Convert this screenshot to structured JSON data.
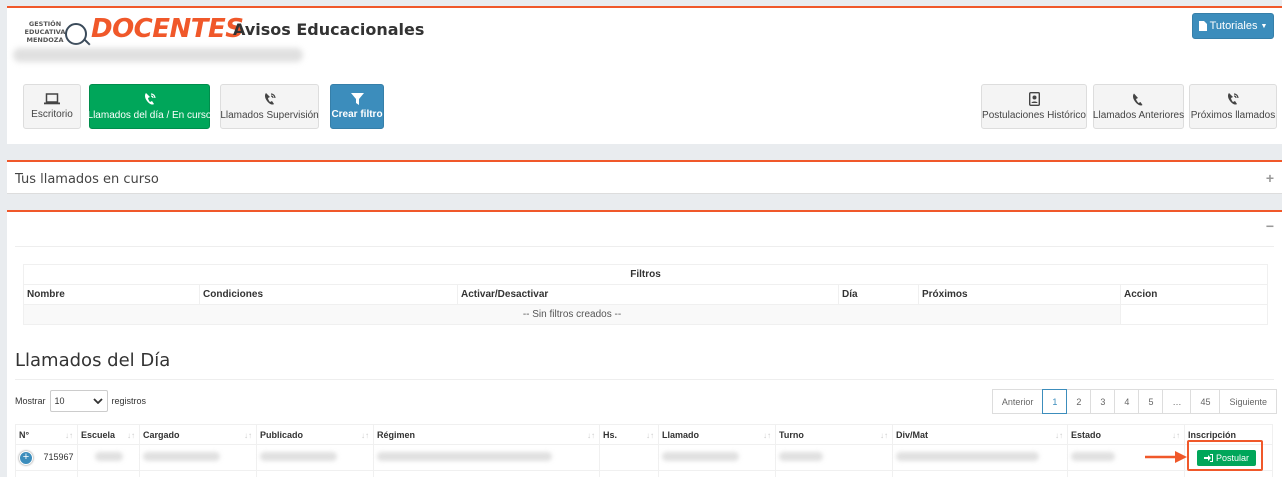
{
  "header": {
    "logo_text": [
      "GESTIÓN",
      "EDUCATIVA",
      "MENDOZA"
    ],
    "brand": "DOCENTES",
    "app_title": "Avisos Educacionales",
    "tutoriales_label": "Tutoriales",
    "nav_left": [
      {
        "label": "Escritorio",
        "icon": "laptop-icon"
      },
      {
        "label": "Llamados del día / En curso",
        "icon": "phone-volume-icon"
      },
      {
        "label": "Llamados Supervisión",
        "icon": "phone-volume-icon"
      },
      {
        "label": "Crear filtro",
        "icon": "filter-icon"
      }
    ],
    "nav_right": [
      {
        "label": "Postulaciones Histórico",
        "icon": "id-card-icon"
      },
      {
        "label": "Llamados Anteriores",
        "icon": "phone-icon"
      },
      {
        "label": "Próximos llamados",
        "icon": "phone-volume-icon"
      }
    ]
  },
  "curso": {
    "title": "Tus llamados en curso",
    "tool": "+"
  },
  "main": {
    "tool": "−",
    "filtros": {
      "caption": "Filtros",
      "columns": [
        "Nombre",
        "Condiciones",
        "Activar/Desactivar",
        "Día",
        "Próximos",
        "Accion"
      ],
      "empty": "-- Sin filtros creados --"
    },
    "llamados_title": "Llamados del Día",
    "mostrar_label": "Mostrar",
    "mostrar_value": "10",
    "registros_label": "registros",
    "pagination": [
      "Anterior",
      "1",
      "2",
      "3",
      "4",
      "5",
      "…",
      "45",
      "Siguiente"
    ],
    "active_page": "1",
    "columns": [
      "N°",
      "Escuela",
      "Cargado",
      "Publicado",
      "Régimen",
      "Hs.",
      "Llamado",
      "Turno",
      "Div/Mat",
      "Estado",
      "Inscripción"
    ],
    "row": {
      "numero": "715967",
      "action": "Postular"
    }
  },
  "colors": {
    "accent": "#f0582a",
    "green": "#00a65a",
    "blue": "#3c8dbc"
  }
}
